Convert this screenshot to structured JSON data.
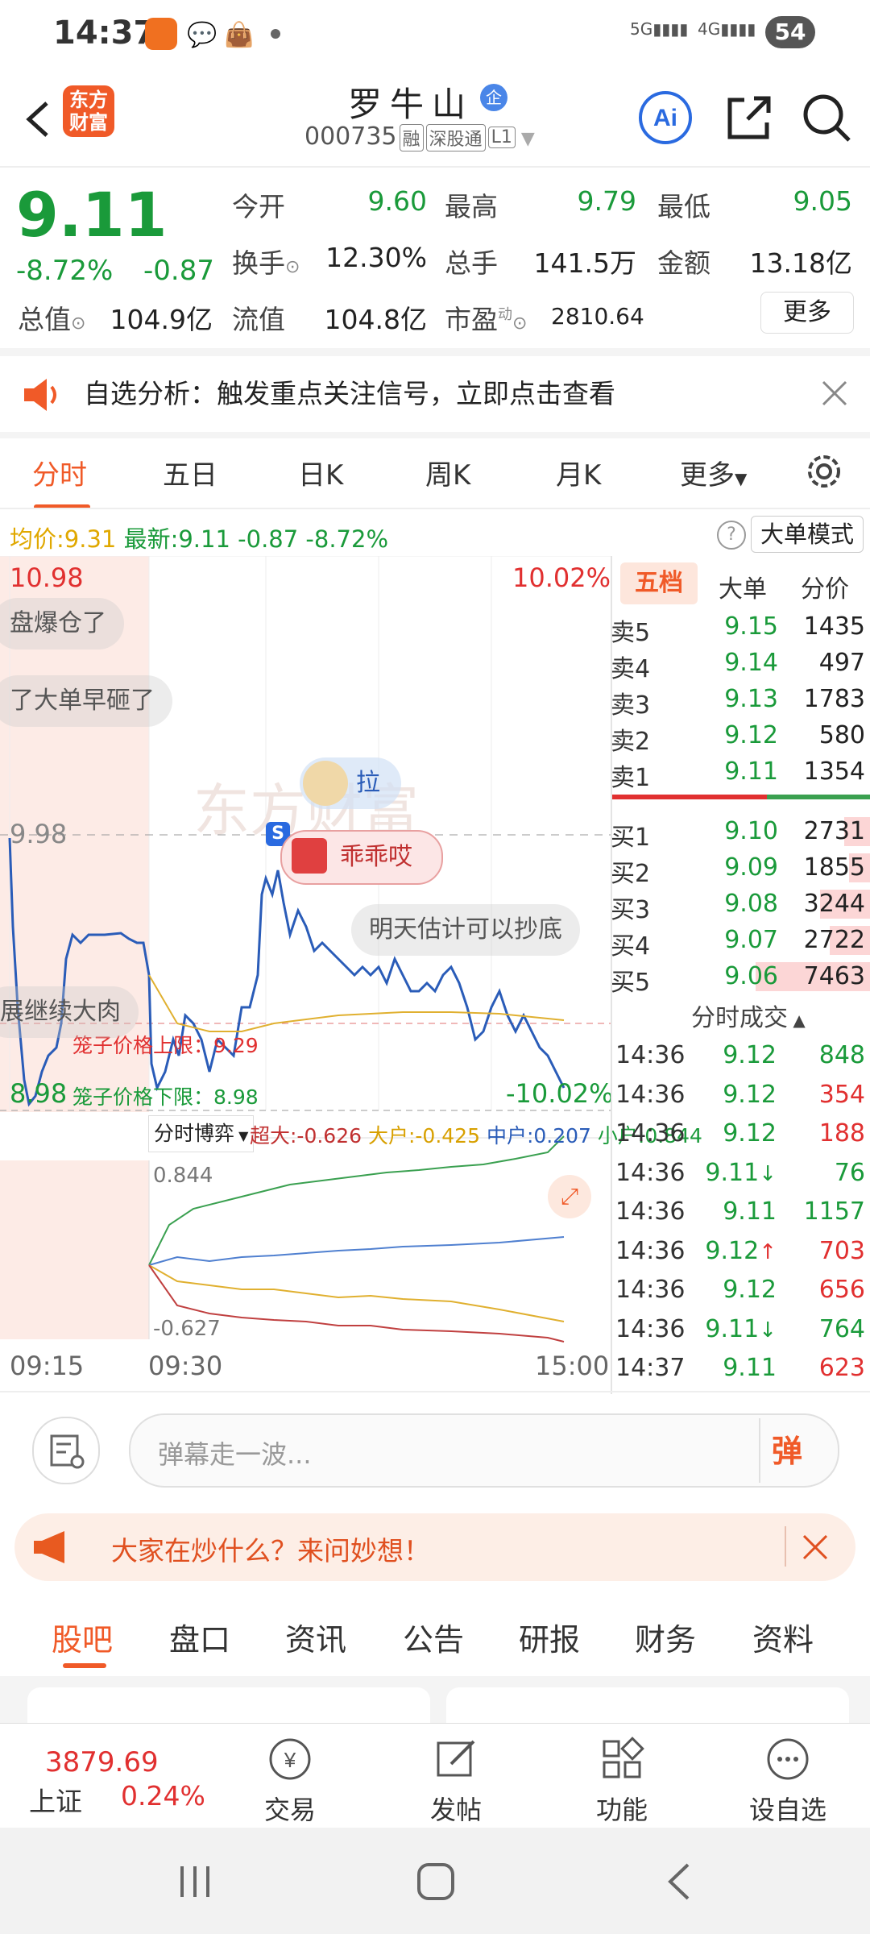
{
  "status": {
    "time": "14:37",
    "battery": "54"
  },
  "header": {
    "logo_line1": "东方",
    "logo_line2": "财富",
    "name": "罗牛山",
    "badge": "企",
    "code": "000735",
    "tags": [
      "融",
      "深股通",
      "L1"
    ]
  },
  "quote": {
    "price": "9.11",
    "pct": "-8.72%",
    "change": "-0.87",
    "open_label": "今开",
    "open": "9.60",
    "high_label": "最高",
    "high": "9.79",
    "low_label": "最低",
    "low": "9.05",
    "turnover_label": "换手",
    "turnover": "12.30%",
    "volume_label": "总手",
    "volume": "141.5万",
    "amount_label": "金额",
    "amount": "13.18亿",
    "mcap_label": "总值",
    "mcap": "104.9亿",
    "float_label": "流值",
    "float": "104.8亿",
    "pe_label": "市盈",
    "pe_sup": "动",
    "pe": "2810.64",
    "more": "更多"
  },
  "notice": {
    "text": "自选分析：触发重点关注信号，立即点击查看"
  },
  "tabs": [
    "分时",
    "五日",
    "日K",
    "周K",
    "月K",
    "更多"
  ],
  "infobar": {
    "avg_label": "均价:",
    "avg": "9.31",
    "latest_label": "最新:",
    "latest": "9.11",
    "chg": "-0.87",
    "pct": "-8.72%",
    "mode": "大单模式"
  },
  "chart": {
    "top_price": "10.98",
    "top_pct": "10.02%",
    "ref_price": "9.98",
    "bottom_price": "8.98",
    "bottom_pct": "-10.02%",
    "upper_limit": "笼子价格上限：9.29",
    "lower_limit": "笼子价格下限：8.98",
    "danmu": [
      "盘爆仓了",
      "了大单早砸了",
      "拉",
      "乖乖哎",
      "明天估计可以抄底",
      "展继续大肉"
    ],
    "watermark": "东方财富",
    "s_badge": "S",
    "flow_label": "分时博弈",
    "flow": {
      "super": "超大:-0.626",
      "big": "大户:-0.425",
      "mid": "中户:0.207",
      "small": "小户:0.844"
    },
    "flow_top": "0.844",
    "flow_bottom": "-0.627",
    "time_start": "09:15",
    "time_open": "09:30",
    "time_end": "15:00"
  },
  "orderbook": {
    "tabs": [
      "五档",
      "大单",
      "分价"
    ],
    "asks": [
      {
        "label": "卖5",
        "price": "9.15",
        "vol": "1435"
      },
      {
        "label": "卖4",
        "price": "9.14",
        "vol": "497"
      },
      {
        "label": "卖3",
        "price": "9.13",
        "vol": "1783"
      },
      {
        "label": "卖2",
        "price": "9.12",
        "vol": "580"
      },
      {
        "label": "卖1",
        "price": "9.11",
        "vol": "1354"
      }
    ],
    "bids": [
      {
        "label": "买1",
        "price": "9.10",
        "vol": "2731"
      },
      {
        "label": "买2",
        "price": "9.09",
        "vol": "1855"
      },
      {
        "label": "买3",
        "price": "9.08",
        "vol": "3244"
      },
      {
        "label": "买4",
        "price": "9.07",
        "vol": "2722"
      },
      {
        "label": "买5",
        "price": "9.06",
        "vol": "7463"
      }
    ],
    "trades_title": "分时成交",
    "trades": [
      {
        "time": "14:36",
        "price": "9.12",
        "vol": "848",
        "color": "#1a9a3a",
        "arrow": ""
      },
      {
        "time": "14:36",
        "price": "9.12",
        "vol": "354",
        "color": "#e13030",
        "arrow": ""
      },
      {
        "time": "14:36",
        "price": "9.12",
        "vol": "188",
        "color": "#e13030",
        "arrow": ""
      },
      {
        "time": "14:36",
        "price": "9.11",
        "vol": "76",
        "color": "#1a9a3a",
        "arrow": "↓"
      },
      {
        "time": "14:36",
        "price": "9.11",
        "vol": "1157",
        "color": "#1a9a3a",
        "arrow": ""
      },
      {
        "time": "14:36",
        "price": "9.12",
        "vol": "703",
        "color": "#e13030",
        "arrow": "↑"
      },
      {
        "time": "14:36",
        "price": "9.12",
        "vol": "656",
        "color": "#e13030",
        "arrow": ""
      },
      {
        "time": "14:36",
        "price": "9.11",
        "vol": "764",
        "color": "#1a9a3a",
        "arrow": "↓"
      },
      {
        "time": "14:37",
        "price": "9.11",
        "vol": "623",
        "color": "#e13030",
        "arrow": ""
      }
    ]
  },
  "comment": {
    "placeholder": "弹幕走一波...",
    "send": "弹"
  },
  "banner": {
    "text": "大家在炒什么？来问妙想！"
  },
  "subtabs": [
    "股吧",
    "盘口",
    "资讯",
    "公告",
    "研报",
    "财务",
    "资料"
  ],
  "bottom": {
    "index_value": "3879.69",
    "index_name": "上证",
    "index_pct": "0.24%",
    "trade": "交易",
    "post": "发帖",
    "func": "功能",
    "watch": "设自选"
  },
  "colors": {
    "accent": "#f05a28",
    "up": "#e13030",
    "down": "#1a9a3a"
  }
}
